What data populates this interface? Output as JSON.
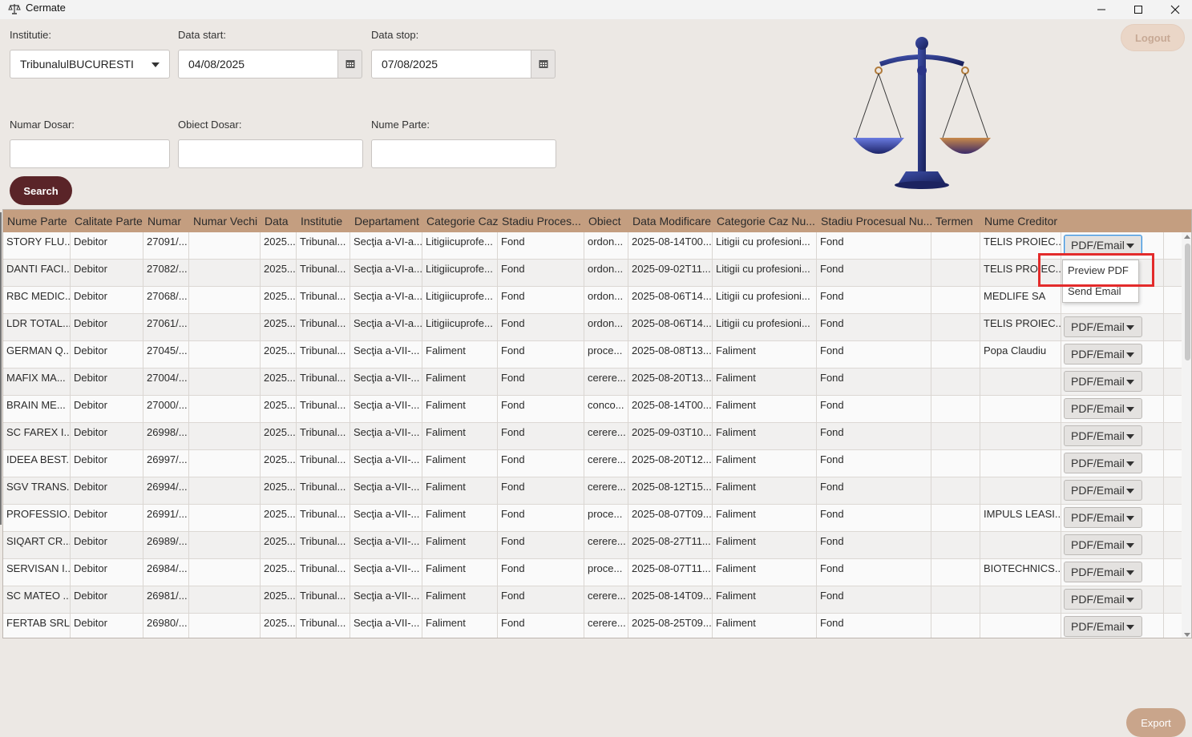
{
  "window": {
    "title": "Cermate",
    "icon": "scales-icon"
  },
  "form": {
    "institutie_label": "Institutie:",
    "institutie_value": "TribunalulBUCURESTI",
    "data_start_label": "Data start:",
    "data_start_value": "04/08/2025",
    "data_stop_label": "Data stop:",
    "data_stop_value": "07/08/2025",
    "numar_dosar_label": "Numar Dosar:",
    "obiect_dosar_label": "Obiect Dosar:",
    "nume_parte_label": "Nume Parte:",
    "search_label": "Search"
  },
  "header": {
    "logout_label": "Logout"
  },
  "footer": {
    "export_label": "Export"
  },
  "table": {
    "columns": [
      "Nume Parte",
      "Calitate Parte",
      "Numar",
      "Numar Vechi",
      "Data",
      "Institutie",
      "Departament",
      "Categorie Caz",
      "Stadiu Proces...",
      "Obiect",
      "Data Modificare",
      "Categorie Caz Nu...",
      "Stadiu Procesual Nu...",
      "Termen",
      "Nume Creditor"
    ],
    "action_label": "PDF/Email",
    "rows": [
      [
        "STORY FLU...",
        "Debitor",
        "27091/...",
        "",
        "2025...",
        "Tribunal...",
        "Secţia a-VI-a...",
        "Litigiicuprofe...",
        "Fond",
        "ordon...",
        "2025-08-14T00...",
        "Litigii cu profesioni...",
        "Fond",
        "",
        "TELIS PROIEC..."
      ],
      [
        "DANTI FACI...",
        "Debitor",
        "27082/...",
        "",
        "2025...",
        "Tribunal...",
        "Secţia a-VI-a...",
        "Litigiicuprofe...",
        "Fond",
        "ordon...",
        "2025-09-02T11...",
        "Litigii cu profesioni...",
        "Fond",
        "",
        "TELIS PROIEC..."
      ],
      [
        "RBC MEDIC...",
        "Debitor",
        "27068/...",
        "",
        "2025...",
        "Tribunal...",
        "Secţia a-VI-a...",
        "Litigiicuprofe...",
        "Fond",
        "ordon...",
        "2025-08-06T14...",
        "Litigii cu profesioni...",
        "Fond",
        "",
        "MEDLIFE SA"
      ],
      [
        "LDR TOTAL...",
        "Debitor",
        "27061/...",
        "",
        "2025...",
        "Tribunal...",
        "Secţia a-VI-a...",
        "Litigiicuprofe...",
        "Fond",
        "ordon...",
        "2025-08-06T14...",
        "Litigii cu profesioni...",
        "Fond",
        "",
        "TELIS PROIEC..."
      ],
      [
        "GERMAN Q...",
        "Debitor",
        "27045/...",
        "",
        "2025...",
        "Tribunal...",
        "Secţia a-VII-...",
        "Faliment",
        "Fond",
        "proce...",
        "2025-08-08T13...",
        "Faliment",
        "Fond",
        "",
        "Popa Claudiu"
      ],
      [
        "MAFIX MA...",
        "Debitor",
        "27004/...",
        "",
        "2025...",
        "Tribunal...",
        "Secţia a-VII-...",
        "Faliment",
        "Fond",
        "cerere...",
        "2025-08-20T13...",
        "Faliment",
        "Fond",
        "",
        ""
      ],
      [
        "BRAIN ME...",
        "Debitor",
        "27000/...",
        "",
        "2025...",
        "Tribunal...",
        "Secţia a-VII-...",
        "Faliment",
        "Fond",
        "conco...",
        "2025-08-14T00...",
        "Faliment",
        "Fond",
        "",
        ""
      ],
      [
        "SC FAREX I...",
        "Debitor",
        "26998/...",
        "",
        "2025...",
        "Tribunal...",
        "Secţia a-VII-...",
        "Faliment",
        "Fond",
        "cerere...",
        "2025-09-03T10...",
        "Faliment",
        "Fond",
        "",
        ""
      ],
      [
        "IDEEA BEST...",
        "Debitor",
        "26997/...",
        "",
        "2025...",
        "Tribunal...",
        "Secţia a-VII-...",
        "Faliment",
        "Fond",
        "cerere...",
        "2025-08-20T12...",
        "Faliment",
        "Fond",
        "",
        ""
      ],
      [
        "SGV TRANS...",
        "Debitor",
        "26994/...",
        "",
        "2025...",
        "Tribunal...",
        "Secţia a-VII-...",
        "Faliment",
        "Fond",
        "cerere...",
        "2025-08-12T15...",
        "Faliment",
        "Fond",
        "",
        ""
      ],
      [
        "PROFESSIO...",
        "Debitor",
        "26991/...",
        "",
        "2025...",
        "Tribunal...",
        "Secţia a-VII-...",
        "Faliment",
        "Fond",
        "proce...",
        "2025-08-07T09...",
        "Faliment",
        "Fond",
        "",
        "IMPULS LEASI..."
      ],
      [
        "SIQART CR...",
        "Debitor",
        "26989/...",
        "",
        "2025...",
        "Tribunal...",
        "Secţia a-VII-...",
        "Faliment",
        "Fond",
        "cerere...",
        "2025-08-27T11...",
        "Faliment",
        "Fond",
        "",
        ""
      ],
      [
        "SERVISAN I...",
        "Debitor",
        "26984/...",
        "",
        "2025...",
        "Tribunal...",
        "Secţia a-VII-...",
        "Faliment",
        "Fond",
        "proce...",
        "2025-08-07T11...",
        "Faliment",
        "Fond",
        "",
        "BIOTECHNICS..."
      ],
      [
        "SC MATEO ...",
        "Debitor",
        "26981/...",
        "",
        "2025...",
        "Tribunal...",
        "Secţia a-VII-...",
        "Faliment",
        "Fond",
        "cerere...",
        "2025-08-14T09...",
        "Faliment",
        "Fond",
        "",
        ""
      ],
      [
        "FERTAB SRL",
        "Debitor",
        "26980/...",
        "",
        "2025...",
        "Tribunal...",
        "Secţia a-VII-...",
        "Faliment",
        "Fond",
        "cerere...",
        "2025-08-25T09...",
        "Faliment",
        "Fond",
        "",
        ""
      ]
    ]
  },
  "popup": {
    "items": [
      "Preview PDF",
      "Send Email"
    ]
  },
  "colors": {
    "background": "#ece8e4",
    "header_bg": "#c49e80",
    "search_btn": "#5a2428",
    "highlight": "#e32b2b"
  }
}
